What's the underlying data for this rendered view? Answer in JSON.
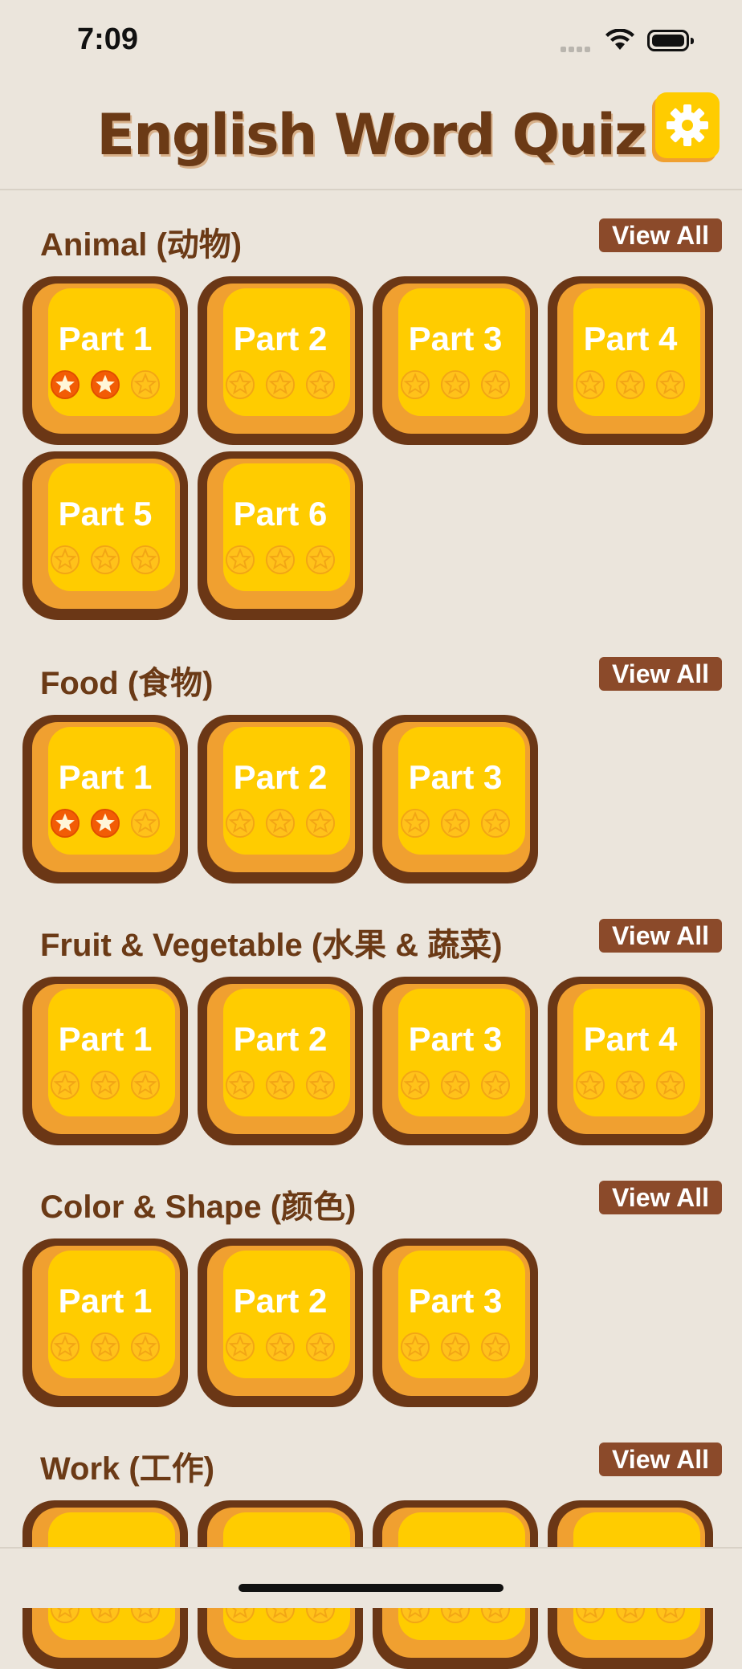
{
  "status": {
    "time": "7:09"
  },
  "header": {
    "title": "English Word Quiz"
  },
  "sections": [
    {
      "title": "Animal (动物)",
      "view_all": "View All",
      "parts": [
        {
          "label": "Part 1",
          "stars": 2
        },
        {
          "label": "Part 2",
          "stars": 0
        },
        {
          "label": "Part 3",
          "stars": 0
        },
        {
          "label": "Part 4",
          "stars": 0
        },
        {
          "label": "Part 5",
          "stars": 0
        },
        {
          "label": "Part 6",
          "stars": 0
        }
      ]
    },
    {
      "title": "Food (食物)",
      "view_all": "View All",
      "parts": [
        {
          "label": "Part 1",
          "stars": 2
        },
        {
          "label": "Part 2",
          "stars": 0
        },
        {
          "label": "Part 3",
          "stars": 0
        }
      ]
    },
    {
      "title": "Fruit & Vegetable (水果 & 蔬菜)",
      "view_all": "View All",
      "parts": [
        {
          "label": "Part 1",
          "stars": 0
        },
        {
          "label": "Part 2",
          "stars": 0
        },
        {
          "label": "Part 3",
          "stars": 0
        },
        {
          "label": "Part 4",
          "stars": 0
        }
      ]
    },
    {
      "title": "Color & Shape (颜色)",
      "view_all": "View All",
      "parts": [
        {
          "label": "Part 1",
          "stars": 0
        },
        {
          "label": "Part 2",
          "stars": 0
        },
        {
          "label": "Part 3",
          "stars": 0
        }
      ]
    },
    {
      "title": "Work (工作)",
      "view_all": "View All",
      "parts": [
        {
          "label": "",
          "stars": 0
        },
        {
          "label": "",
          "stars": 0
        },
        {
          "label": "",
          "stars": 0
        },
        {
          "label": "",
          "stars": 0
        }
      ]
    }
  ],
  "colors": {
    "background": "#ebe5dc",
    "tile": "#ffcc00",
    "tile_shadow": "#f0a030",
    "tile_outline": "#6b3716",
    "title_brown": "#6b3a16",
    "button_brown": "#8b4a2a",
    "star_earned": "#f25c05",
    "star_empty": "#f2a515"
  }
}
